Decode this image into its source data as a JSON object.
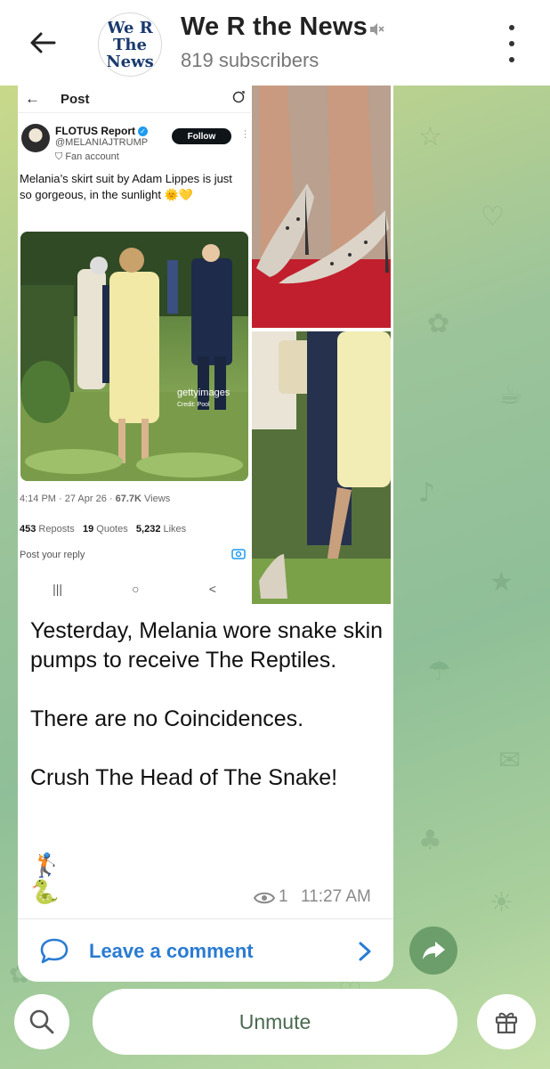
{
  "header": {
    "title": "We R the News",
    "subscribers": "819 subscribers",
    "avatar_line1": "We R",
    "avatar_line2": "The",
    "avatar_line3": "News"
  },
  "tweet": {
    "screen_title": "Post",
    "author_name": "FLOTUS Report",
    "author_handle": "@MELANIAJTRUMP",
    "fan_label": "Fan account",
    "follow_label": "Follow",
    "text": "Melania’s skirt suit by Adam Lippes is just so gorgeous, in the sunlight 🌞💛",
    "watermark": "gettyimages",
    "credit": "Credit: Pool",
    "time": "4:14 PM",
    "date": "27 Apr 26",
    "views": "67.7K",
    "views_label": "Views",
    "reposts": "453",
    "reposts_label": "Reposts",
    "quotes": "19",
    "quotes_label": "Quotes",
    "likes": "5,232",
    "likes_label": "Likes",
    "reply_placeholder": "Post your reply",
    "nav_recent": "|||",
    "nav_home": "○",
    "nav_back": "<"
  },
  "message": {
    "text": "Yesterday,  Melania wore snake skin pumps to receive The Reptiles.\n\nThere are no Coincidences.\n\nCrush The Head of The Snake!",
    "emoji_1": "🏌",
    "emoji_2": "🐍",
    "views": "1",
    "time": "11:27 AM",
    "comment_label": "Leave a comment"
  },
  "bottom_bar": {
    "unmute_label": "Unmute"
  },
  "colors": {
    "accent_blue": "#2a7bd2",
    "share_green": "#6b9e6a",
    "wallpaper_green": "#8fbf98"
  },
  "icons": [
    "back-arrow-icon",
    "mute-icon",
    "more-vertical-icon",
    "eye-icon",
    "comment-bubble-icon",
    "chevron-right-icon",
    "share-arrow-icon",
    "search-icon",
    "gift-icon"
  ]
}
